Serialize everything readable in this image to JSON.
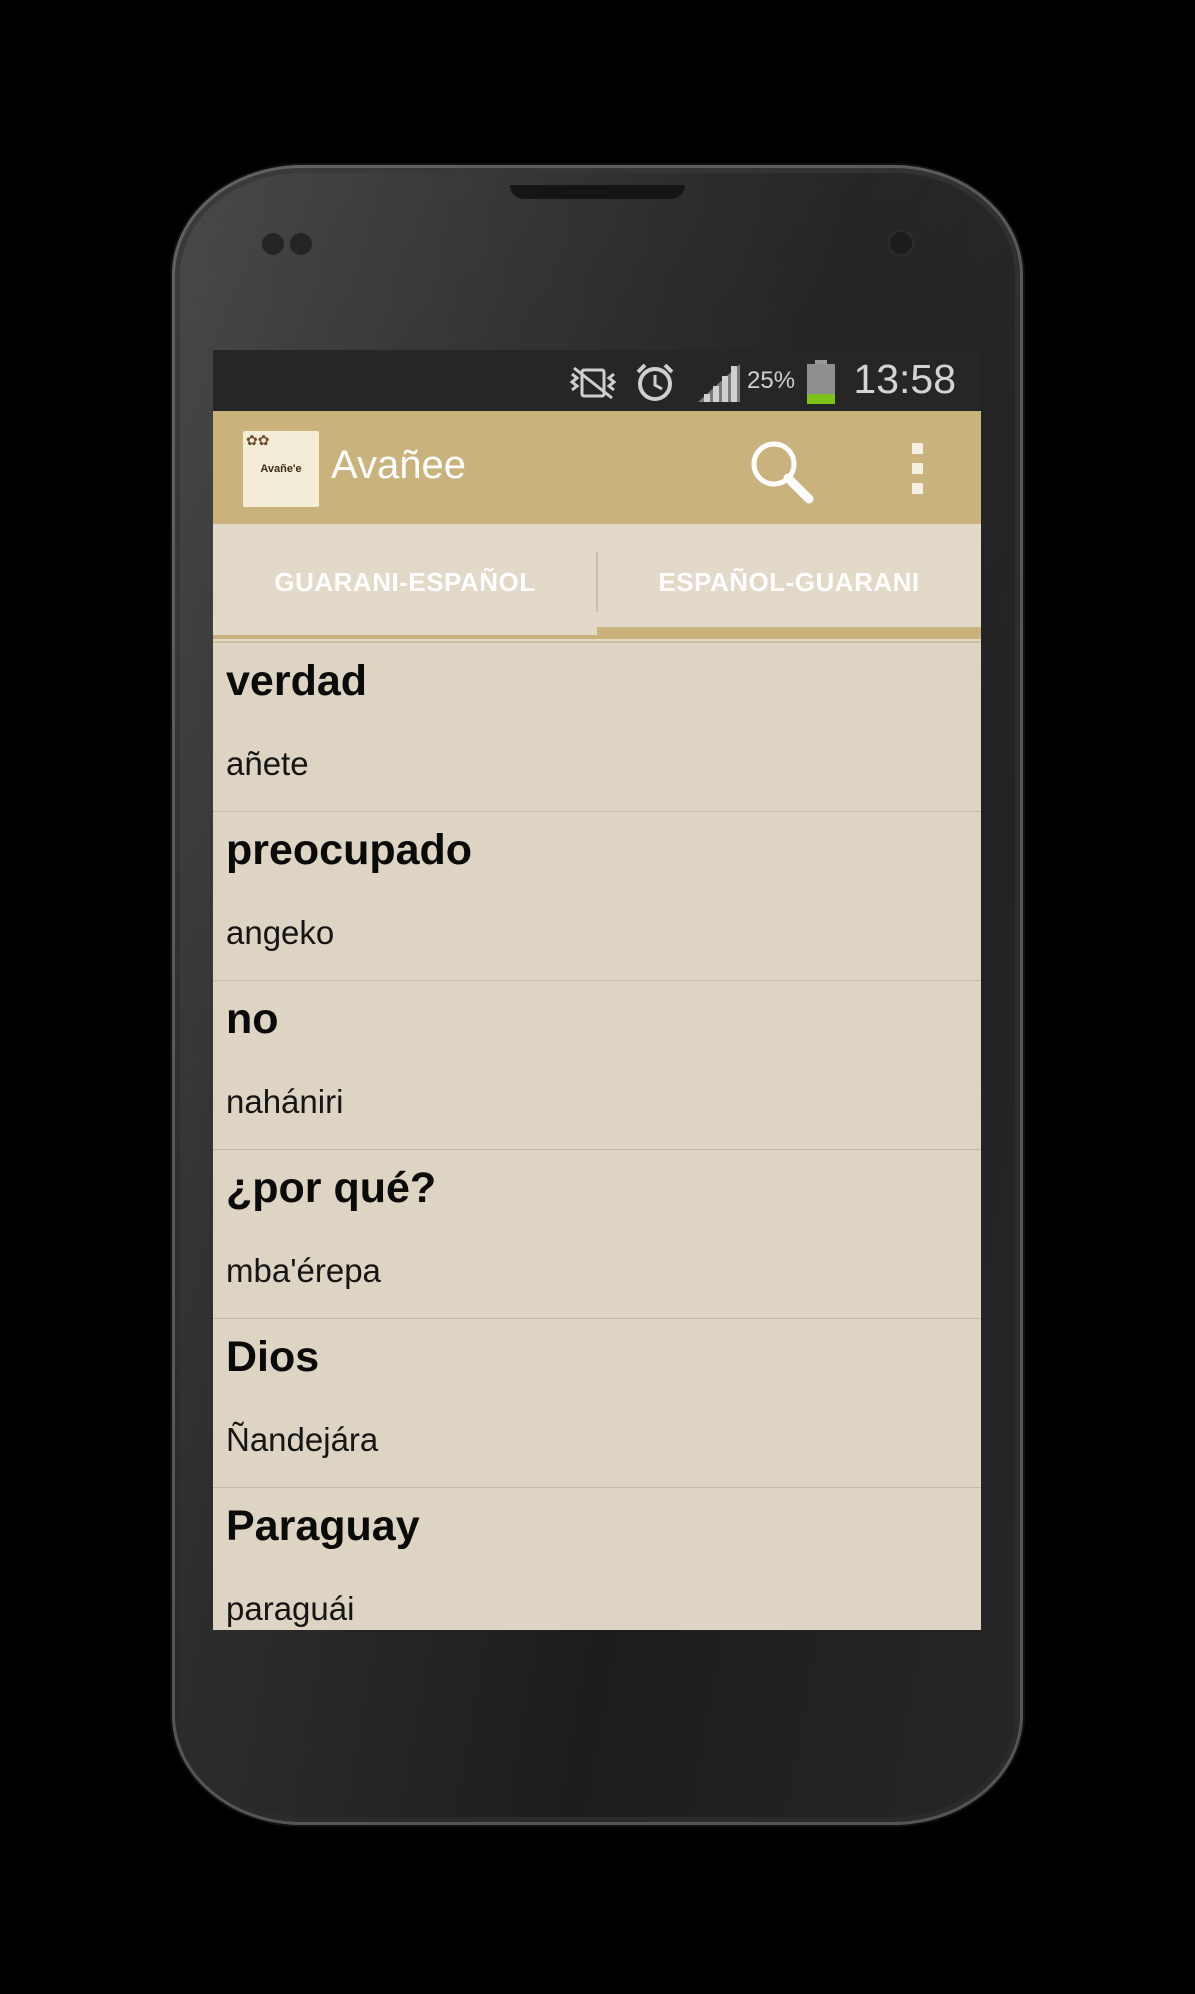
{
  "status_bar": {
    "battery_percent": "25%",
    "time": "13:58",
    "icons": [
      "vibrate-icon",
      "alarm-icon",
      "signal-icon",
      "battery-icon"
    ]
  },
  "app_bar": {
    "logo_text": "Avañe'e",
    "title": "Avañee",
    "search_icon": "search-icon",
    "overflow_icon": "more-vert-icon",
    "color": "#c9b27c"
  },
  "tabs": [
    {
      "label": "GUARANI-ESPAÑOL",
      "selected": false
    },
    {
      "label": "ESPAÑOL-GUARANI",
      "selected": true
    }
  ],
  "entries": [
    {
      "word": "verdad",
      "translation": "añete"
    },
    {
      "word": "preocupado",
      "translation": "angeko"
    },
    {
      "word": "no",
      "translation": "nahániri"
    },
    {
      "word": "¿por qué?",
      "translation": "mba'érepa"
    },
    {
      "word": "Dios",
      "translation": "Ñandejára"
    },
    {
      "word": "Paraguay",
      "translation": "paraguái"
    }
  ]
}
